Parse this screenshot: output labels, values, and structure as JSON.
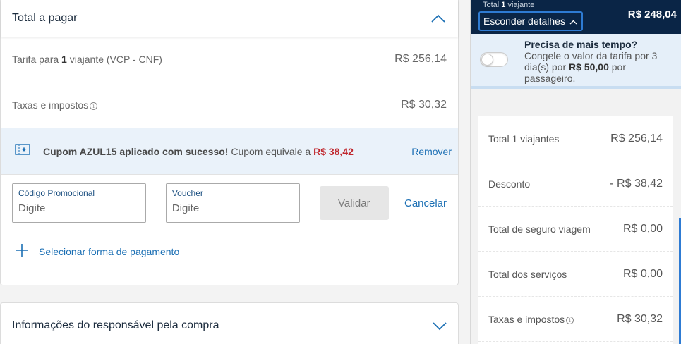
{
  "payment": {
    "title": "Total a pagar",
    "fare_prefix": "Tarifa para ",
    "fare_count": "1",
    "fare_suffix": " viajante (VCP - CNF)",
    "fare_value": "R$ 256,14",
    "taxes_label": "Taxas e impostos",
    "taxes_value": "R$ 30,32",
    "coupon": {
      "success": "Cupom AZUL15 aplicado com sucesso!",
      "equiv": " Cupom equivale a ",
      "value": "R$ 38,42",
      "remove": "Remover"
    },
    "promo_label": "Código Promocional",
    "promo_placeholder": "Digite",
    "voucher_label": "Voucher",
    "voucher_placeholder": "Digite",
    "validate": "Validar",
    "cancel": "Cancelar",
    "select_payment": "Selecionar forma de pagamento"
  },
  "responsible": {
    "title": "Informações do responsável pela compra"
  },
  "sidebar": {
    "total_prefix": "Total ",
    "total_count": "1",
    "total_suffix": " viajante",
    "hide_details": "Esconder detalhes",
    "total_value": "R$ 248,04",
    "freeze": {
      "title": "Precisa de mais tempo?",
      "desc_a": "Congele o valor da tarifa por 3 dia(s) por ",
      "desc_price": "R$ 50,00",
      "desc_b": " por passageiro."
    },
    "summary": [
      {
        "label": "Total 1 viajantes",
        "value": "R$ 256,14"
      },
      {
        "label": "Desconto",
        "value": "- R$ 38,42"
      },
      {
        "label": "Total de seguro viagem",
        "value": "R$ 0,00"
      },
      {
        "label": "Total dos serviços",
        "value": "R$ 0,00"
      },
      {
        "label": "Taxas e impostos",
        "value": "R$ 30,32"
      }
    ]
  },
  "colors": {
    "primary_blue": "#1b6fb4",
    "navy": "#0a2546",
    "discount_red": "#c0272d"
  }
}
